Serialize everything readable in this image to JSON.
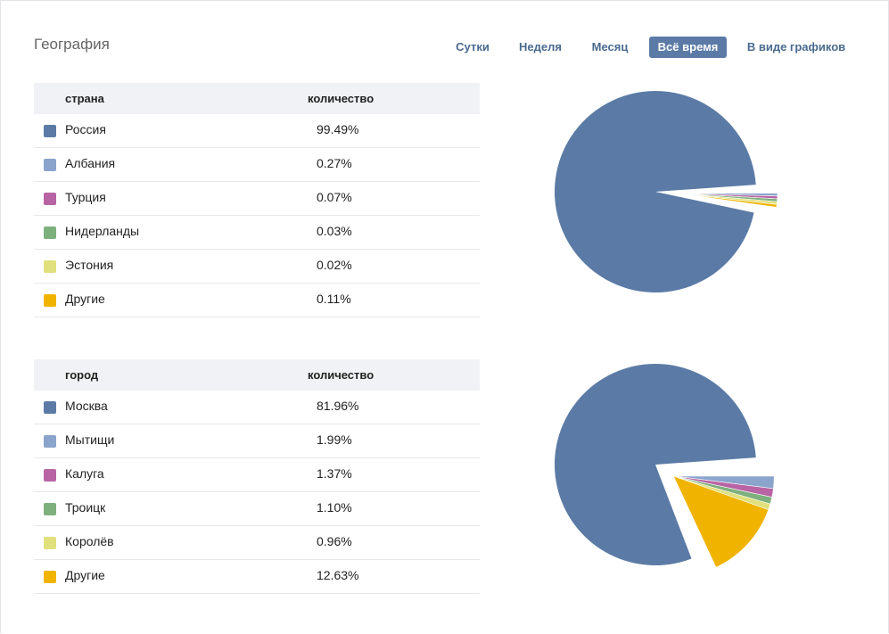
{
  "header": {
    "title": "География"
  },
  "tabs": [
    {
      "label": "Сутки",
      "active": false
    },
    {
      "label": "Неделя",
      "active": false
    },
    {
      "label": "Месяц",
      "active": false
    },
    {
      "label": "Всё время",
      "active": true
    },
    {
      "label": "В виде графиков",
      "active": false
    }
  ],
  "colors": {
    "blue": "#5b7ba6",
    "light_blue": "#8aa4cc",
    "pink": "#b864a4",
    "green": "#7db07d",
    "yellow": "#e0e07c",
    "orange": "#f0b400"
  },
  "countries": {
    "col_name": "страна",
    "col_value": "количество",
    "rows": [
      {
        "label": "Россия",
        "value": "99.49%",
        "color": "#5b7ba6"
      },
      {
        "label": "Албания",
        "value": "0.27%",
        "color": "#8aa4cc"
      },
      {
        "label": "Турция",
        "value": "0.07%",
        "color": "#b864a4"
      },
      {
        "label": "Нидерланды",
        "value": "0.03%",
        "color": "#7db07d"
      },
      {
        "label": "Эстония",
        "value": "0.02%",
        "color": "#e0e07c"
      },
      {
        "label": "Другие",
        "value": "0.11%",
        "color": "#f0b400"
      }
    ]
  },
  "cities": {
    "col_name": "город",
    "col_value": "количество",
    "rows": [
      {
        "label": "Москва",
        "value": "81.96%",
        "color": "#5b7ba6"
      },
      {
        "label": "Мытищи",
        "value": "1.99%",
        "color": "#8aa4cc"
      },
      {
        "label": "Калуга",
        "value": "1.37%",
        "color": "#b864a4"
      },
      {
        "label": "Троицк",
        "value": "1.10%",
        "color": "#7db07d"
      },
      {
        "label": "Королёв",
        "value": "0.96%",
        "color": "#e0e07c"
      },
      {
        "label": "Другие",
        "value": "12.63%",
        "color": "#f0b400"
      }
    ]
  },
  "chart_data": [
    {
      "type": "pie",
      "categories": [
        "Россия",
        "Албания",
        "Турция",
        "Нидерланды",
        "Эстония",
        "Другие"
      ],
      "values": [
        99.49,
        0.27,
        0.07,
        0.03,
        0.02,
        0.11
      ],
      "colors": [
        "#5b7ba6",
        "#8aa4cc",
        "#b864a4",
        "#7db07d",
        "#e0e07c",
        "#f0b400"
      ]
    },
    {
      "type": "pie",
      "categories": [
        "Москва",
        "Мытищи",
        "Калуга",
        "Троицк",
        "Королёв",
        "Другие"
      ],
      "values": [
        81.96,
        1.99,
        1.37,
        1.1,
        0.96,
        12.63
      ],
      "colors": [
        "#5b7ba6",
        "#8aa4cc",
        "#b864a4",
        "#7db07d",
        "#e0e07c",
        "#f0b400"
      ]
    }
  ]
}
